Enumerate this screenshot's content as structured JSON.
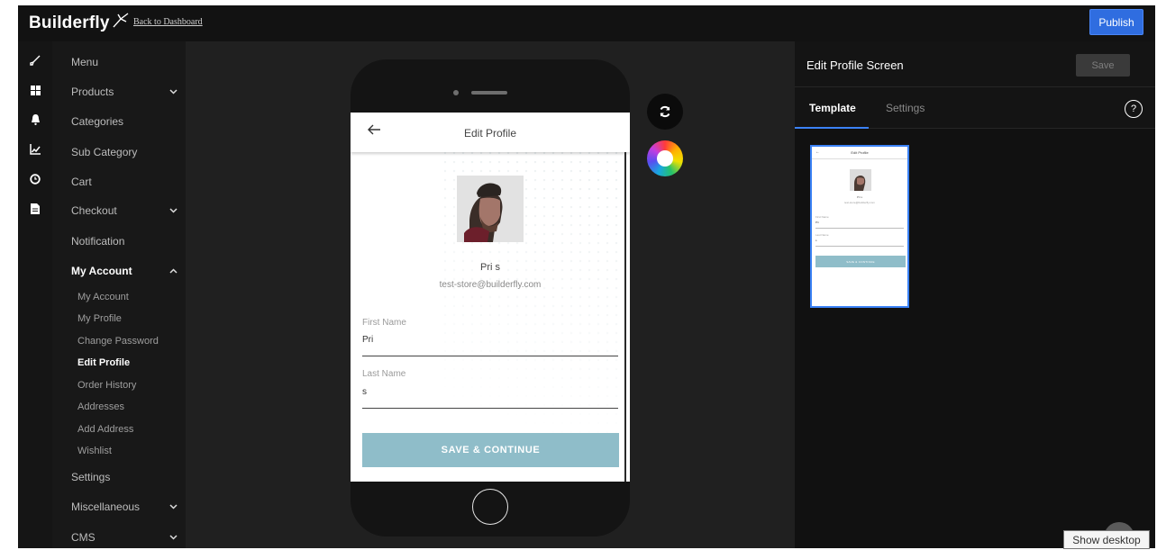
{
  "header": {
    "logo_text": "Builderfly",
    "back_link": "Back to Dashboard",
    "publish_label": "Publish"
  },
  "rail": {
    "icons": [
      "brush-icon",
      "grid-icon",
      "bell-icon",
      "chart-icon",
      "clock-icon",
      "document-icon"
    ]
  },
  "nav": {
    "items": [
      {
        "label": "Menu",
        "has_chevron": false
      },
      {
        "label": "Products",
        "has_chevron": true,
        "chevron": "down"
      },
      {
        "label": "Categories",
        "has_chevron": false
      },
      {
        "label": "Sub Category",
        "has_chevron": false
      },
      {
        "label": "Cart",
        "has_chevron": false
      },
      {
        "label": "Checkout",
        "has_chevron": true,
        "chevron": "down"
      },
      {
        "label": "Notification",
        "has_chevron": false
      },
      {
        "label": "My Account",
        "has_chevron": true,
        "chevron": "up",
        "expanded": true
      },
      {
        "label": "Settings",
        "has_chevron": false
      },
      {
        "label": "Miscellaneous",
        "has_chevron": true,
        "chevron": "down"
      },
      {
        "label": "CMS",
        "has_chevron": true,
        "chevron": "down"
      }
    ],
    "subitems": [
      {
        "label": "My Account",
        "active": false
      },
      {
        "label": "My Profile",
        "active": false
      },
      {
        "label": "Change Password",
        "active": false
      },
      {
        "label": "Edit Profile",
        "active": true
      },
      {
        "label": "Order History",
        "active": false
      },
      {
        "label": "Addresses",
        "active": false
      },
      {
        "label": "Add Address",
        "active": false
      },
      {
        "label": "Wishlist",
        "active": false
      }
    ]
  },
  "preview": {
    "screen_title": "Edit Profile",
    "profile_name": "Pri s",
    "profile_email": "test-store@builderfly.com",
    "first_name_label": "First Name",
    "first_name_value": "Pri",
    "last_name_label": "Last Name",
    "last_name_value": "s",
    "save_button": "SAVE & CONTINUE",
    "button_color": "#8fbdc9"
  },
  "right_panel": {
    "title": "Edit Profile Screen",
    "save_label": "Save",
    "tabs": [
      {
        "label": "Template",
        "active": true
      },
      {
        "label": "Settings",
        "active": false
      }
    ],
    "help_label": "?"
  },
  "tooltip": {
    "text": "Show desktop"
  },
  "colors": {
    "accent": "#2f6de0",
    "tab_underline": "#3b82f6",
    "app_background": "#1b1b1b"
  }
}
